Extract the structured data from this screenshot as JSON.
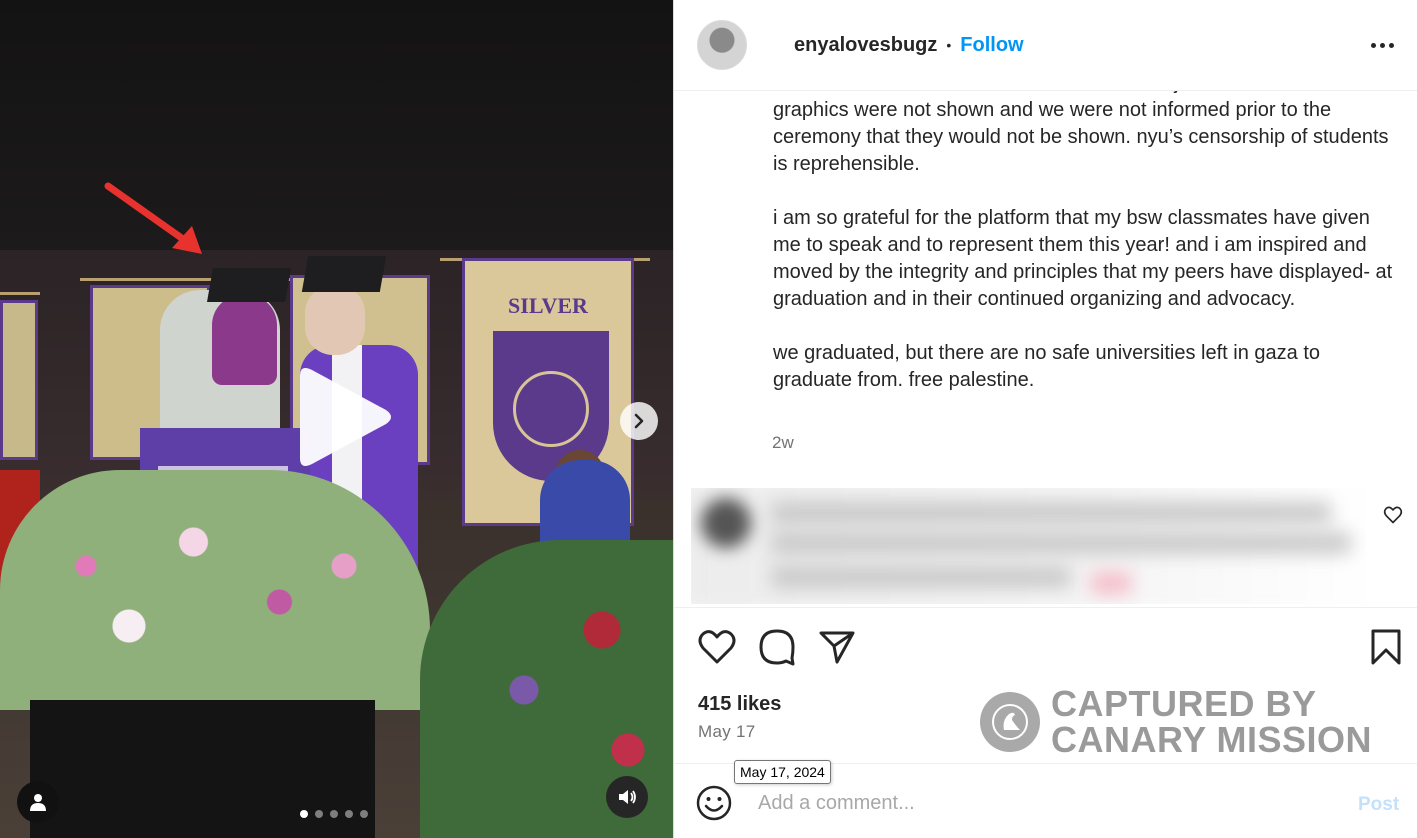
{
  "post": {
    "username": "enyalovesbugz",
    "separator": "•",
    "follow_label": "Follow",
    "caption": {
      "cut_line": "would be informed if our submissions were rejected. our",
      "paragraphs": [
        "graphics were not shown and we were not informed prior to the ceremony that they would not be shown. nyu’s censorship of students is reprehensible.",
        "i am so grateful for the platform that my bsw classmates have given me to speak and to represent them this year! and i am inspired and moved by the integrity and principles that my peers have displayed- at graduation and in their continued organizing and advocacy.",
        "we graduated, but there are no safe universities left in gaza to graduate from. free palestine."
      ]
    },
    "time_ago": "2w",
    "likes": "415 likes",
    "date": "May 17",
    "date_tooltip": "May 17, 2024"
  },
  "media": {
    "banner_title": "SILVER",
    "carousel_count": 5,
    "carousel_active": 0
  },
  "watermark": {
    "line1": "CAPTURED BY",
    "line2": "CANARY MISSION"
  },
  "comment_box": {
    "placeholder": "Add a comment...",
    "post_label": "Post"
  },
  "colors": {
    "accent": "#0095f6",
    "post_disabled": "#c4e1fb",
    "muted": "#737373",
    "gown": "#6a3fc0"
  },
  "icons": [
    "play-icon",
    "chevron-right-icon",
    "user-icon",
    "sound-icon",
    "more-icon",
    "heart-icon",
    "comment-icon",
    "share-icon",
    "bookmark-icon",
    "emoji-icon",
    "canary-logo-icon",
    "arrow-annotation-icon"
  ]
}
